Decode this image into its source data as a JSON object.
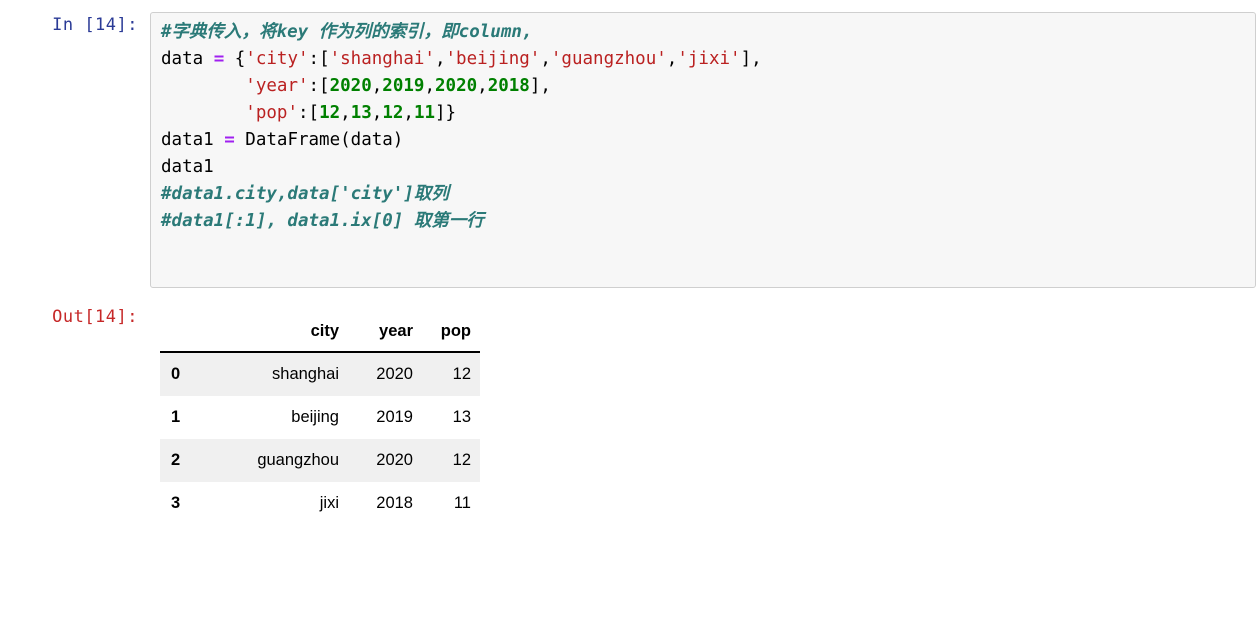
{
  "cell": {
    "input_prompt": "In [14]:",
    "output_prompt": "Out[14]:",
    "code_lines": [
      [
        {
          "t": "comment",
          "s": "#字典传入，将key 作为列的索引，即column,"
        }
      ],
      [
        {
          "t": "plain",
          "s": "data "
        },
        {
          "t": "op",
          "s": "="
        },
        {
          "t": "plain",
          "s": " {"
        },
        {
          "t": "string",
          "s": "'city'"
        },
        {
          "t": "plain",
          "s": ":["
        },
        {
          "t": "string",
          "s": "'shanghai'"
        },
        {
          "t": "plain",
          "s": ","
        },
        {
          "t": "string",
          "s": "'beijing'"
        },
        {
          "t": "plain",
          "s": ","
        },
        {
          "t": "string",
          "s": "'guangzhou'"
        },
        {
          "t": "plain",
          "s": ","
        },
        {
          "t": "string",
          "s": "'jixi'"
        },
        {
          "t": "plain",
          "s": "],"
        }
      ],
      [
        {
          "t": "plain",
          "s": "        "
        },
        {
          "t": "string",
          "s": "'year'"
        },
        {
          "t": "plain",
          "s": ":["
        },
        {
          "t": "number",
          "s": "2020"
        },
        {
          "t": "plain",
          "s": ","
        },
        {
          "t": "number",
          "s": "2019"
        },
        {
          "t": "plain",
          "s": ","
        },
        {
          "t": "number",
          "s": "2020"
        },
        {
          "t": "plain",
          "s": ","
        },
        {
          "t": "number",
          "s": "2018"
        },
        {
          "t": "plain",
          "s": "],"
        }
      ],
      [
        {
          "t": "plain",
          "s": "        "
        },
        {
          "t": "string",
          "s": "'pop'"
        },
        {
          "t": "plain",
          "s": ":["
        },
        {
          "t": "number",
          "s": "12"
        },
        {
          "t": "plain",
          "s": ","
        },
        {
          "t": "number",
          "s": "13"
        },
        {
          "t": "plain",
          "s": ","
        },
        {
          "t": "number",
          "s": "12"
        },
        {
          "t": "plain",
          "s": ","
        },
        {
          "t": "number",
          "s": "11"
        },
        {
          "t": "plain",
          "s": "]}"
        }
      ],
      [
        {
          "t": "plain",
          "s": "data1 "
        },
        {
          "t": "op",
          "s": "="
        },
        {
          "t": "plain",
          "s": " DataFrame(data)"
        }
      ],
      [
        {
          "t": "plain",
          "s": "data1"
        }
      ],
      [
        {
          "t": "comment",
          "s": "#data1.city,data['city']取列"
        }
      ],
      [
        {
          "t": "comment",
          "s": "#data1[:1], data1.ix[0] 取第一行"
        }
      ]
    ]
  },
  "dataframe": {
    "index_header": "",
    "columns": [
      "city",
      "year",
      "pop"
    ],
    "index": [
      "0",
      "1",
      "2",
      "3"
    ],
    "rows": [
      [
        "shanghai",
        "2020",
        "12"
      ],
      [
        "beijing",
        "2019",
        "13"
      ],
      [
        "guangzhou",
        "2020",
        "12"
      ],
      [
        "jixi",
        "2018",
        "11"
      ]
    ]
  },
  "colors": {
    "prompt_in": "#2a3a96",
    "prompt_out": "#c62828",
    "comment": "#2b7a78",
    "string": "#ba2121",
    "number": "#008000",
    "operator": "#a020f0",
    "cell_background": "#f7f7f7",
    "cell_border": "#cfcfcf",
    "row_stripe": "#f0f0f0"
  }
}
